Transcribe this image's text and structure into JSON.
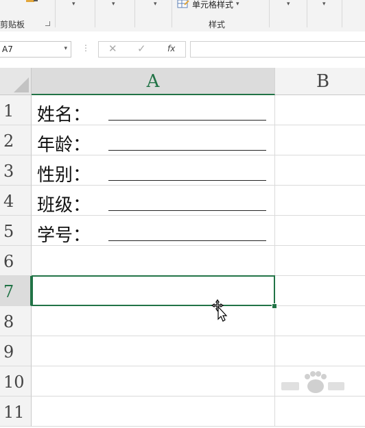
{
  "ribbon": {
    "clipboard_label": "剪贴板",
    "cell_styles_label": "单元格样式",
    "styles_group_label": "样式"
  },
  "formula_bar": {
    "name_box": "A7",
    "cancel_icon": "✕",
    "enter_icon": "✓",
    "fx_label": "fx",
    "formula": ""
  },
  "grid": {
    "columns": [
      "A",
      "B"
    ],
    "active_column": "A",
    "rows": [
      "1",
      "2",
      "3",
      "4",
      "5",
      "6",
      "7",
      "8",
      "9",
      "10",
      "11"
    ],
    "active_row": "7",
    "cells": [
      {
        "row": "1",
        "A": "姓名：",
        "underlined": true
      },
      {
        "row": "2",
        "A": "年龄：",
        "underlined": true
      },
      {
        "row": "3",
        "A": "性别：",
        "underlined": true
      },
      {
        "row": "4",
        "A": "班级：",
        "underlined": true
      },
      {
        "row": "5",
        "A": "学号：",
        "underlined": true
      }
    ],
    "selected_cell": "A7"
  },
  "colors": {
    "accent": "#217346",
    "header_bg": "#f3f3f3",
    "gridline": "#dadada"
  },
  "icons": [
    "format-painter-icon",
    "cell-styles-icon",
    "move-cursor-icon",
    "baidu-watermark-icon"
  ]
}
